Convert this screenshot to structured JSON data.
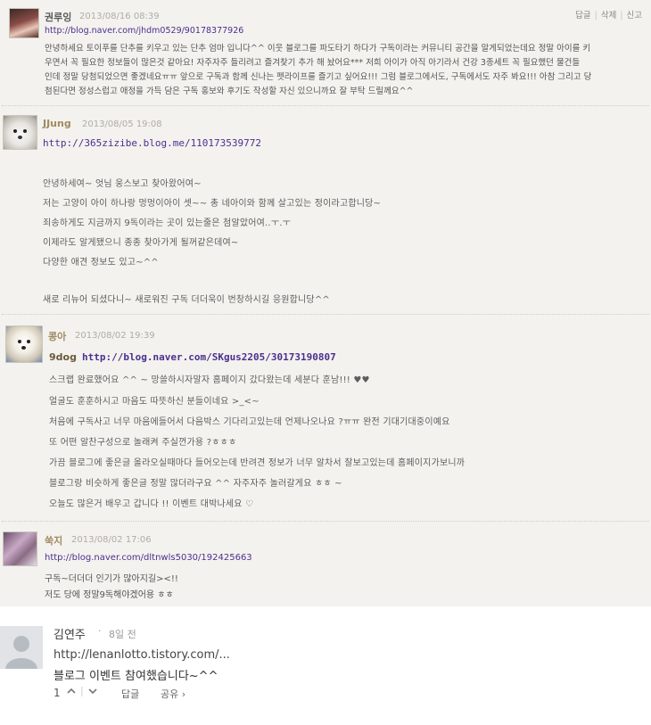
{
  "thread_actions": {
    "reply": "답글",
    "delete": "삭제",
    "report": "신고",
    "sep": "|"
  },
  "comments": [
    {
      "name": "권루잉",
      "date": "2013/08/16 08:39",
      "link": "http://blog.naver.com/jhdm0529/90178377926",
      "lines": [
        "안녕하세요 토이푸를 단추를 키우고 있는 단추 엄마 입니다^^ 이웃 블로그를 파도타기 하다가 구독이라는 커뮤니티 공간을 알게되었는데요 정말 아이를 키",
        "우면서 꼭 필요한 정보들이 많은것 같아요! 자주자주 들리려고 즐겨찾기 추가 해 놨어요*** 저희 아이가 아직 아기라서 건강 3종세트 꼭 필요했던 물건들",
        "인데 정말 당첨되었으면 좋겠네요ㅠㅠ 앞으로 구독과 함께 신나는 펫라이프를 즐기고 싶어요!!! 그럼 블로그에서도, 구독에서도 자주 봐요!!! 아참 그리고 당",
        "첨된다면 정성스럽고 애정을 가득 담은 구독 홍보와 후기도 작성할 자신 있으니까요 잘 부탁 드릴께요^^"
      ]
    },
    {
      "name": "JJung",
      "date": "2013/08/05 19:08",
      "link": "http://365zizibe.blog.me/110173539772",
      "lines": [
        "안녕하세여~ 엇님 웅스보고 찾아왔어여~",
        "저는 고양이 아이 하나랑 멍멍이아이 셋~~ 총 네아이와 함께 살고있는 정이라고합니당~",
        "죄송하게도 지금까지 9독이라는 곳이 있는줄은 첨알았어여..ㅜ.ㅜ",
        "이제라도 알게됐으니 종종 찾아가게 될꺼같은데여~",
        "다양한 애견 정보도 있고~^^",
        "",
        "새로 리뉴어 되셨다니~ 새로워진 구독 더더욱이 번창하시길 응원합니당^^"
      ]
    },
    {
      "name": "콩아",
      "date": "2013/08/02 19:39",
      "link_label": "9dog",
      "link": "http://blog.naver.com/SKgus2205/30173190807",
      "lines": [
        "스크랩 완료했어요 ^^ ~ 망쓸하시자말자 홈페이지 갔다왔는데 세분다 훈남!!! ♥♥",
        "얼굴도 훈훈하시고 마음도 따뜻하신 분들이네요 >_<~",
        "처음에 구독사고 너무 마음에들어서 다음박스 기다리고있는데 언제나오나요 ?ㅠㅠ 완전 기대기대중이예요",
        "또 어떤 알찬구성으로 놀래켜 주실껀가용 ?ㅎㅎㅎ",
        "가끔 블로그에 좋은글 올라오실때마다 들어오는데 반려견 정보가 너무 알차서 잘보고있는데 홈페이지가보니까",
        "블로그랑 비슷하게 좋은글 정말 많더라구요 ^^ 자주자주 놀러갈게요 ㅎㅎ ~",
        "오늘도 많은거 배우고 갑니다 !! 이벤트 대박나세요 ♡"
      ]
    },
    {
      "name": "쑥지",
      "date": "2013/08/02 17:06",
      "link": "http://blog.naver.com/dltnwls5030/192425663",
      "lines": [
        "구독~더더더 인기가 많아지길><!!",
        "저도 당에 정말9독해야겠어용 ㅎㅎ"
      ]
    }
  ],
  "reply_comment": {
    "name": "김연주",
    "dot": "·",
    "age": "8일 전",
    "url": "http://lenanlotto.tistory.com/...",
    "body": "블로그 이벤트 참여했습니다~^^",
    "likes": "1",
    "reply": "답글",
    "share": "공유 ›"
  }
}
